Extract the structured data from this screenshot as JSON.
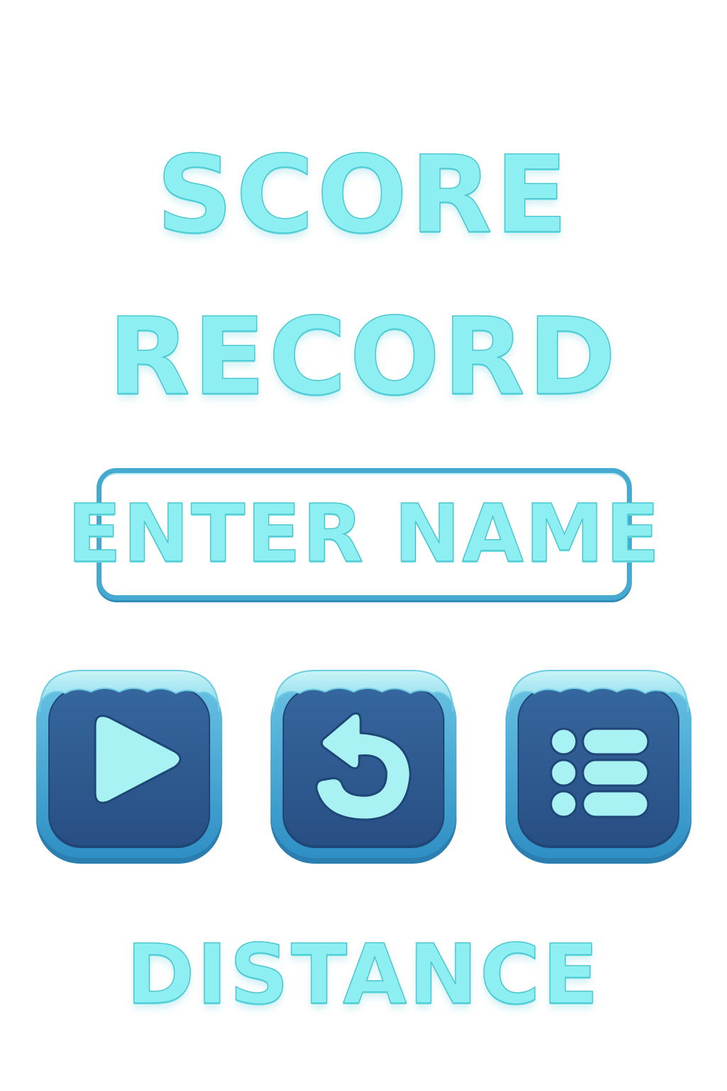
{
  "title": {
    "line1": "SCORE",
    "line2": "RECORD"
  },
  "name_field": {
    "value": "ENTER NAME"
  },
  "buttons": [
    {
      "icon": "play-icon"
    },
    {
      "icon": "replay-icon"
    },
    {
      "icon": "menu-list-icon"
    }
  ],
  "footer_label": "DISTANCE",
  "colors": {
    "text_fill": "#8eeff2",
    "text_outline": "#4cc6cf",
    "frame_blue": "#45a9d0",
    "panel_navy": "#2f5d94",
    "icon_fill": "#a8f2f4"
  }
}
